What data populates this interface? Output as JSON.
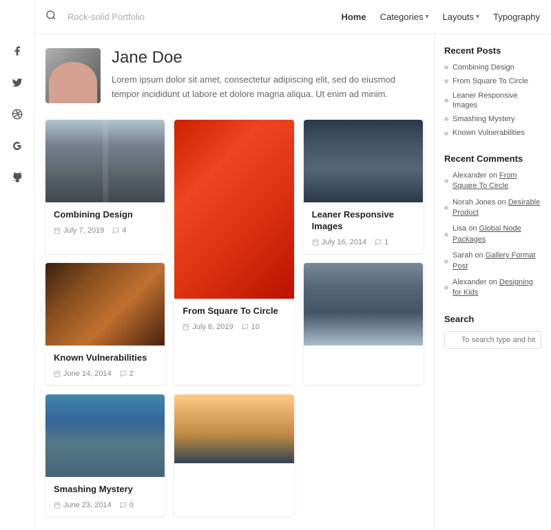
{
  "nav": {
    "site_title": "Rock-solid Portfolio",
    "links": [
      {
        "label": "Home",
        "active": true,
        "has_dropdown": false
      },
      {
        "label": "Categories",
        "active": false,
        "has_dropdown": true
      },
      {
        "label": "Layouts",
        "active": false,
        "has_dropdown": true
      },
      {
        "label": "Typography",
        "active": false,
        "has_dropdown": false
      }
    ]
  },
  "social": [
    {
      "icon": "facebook",
      "symbol": "f"
    },
    {
      "icon": "twitter",
      "symbol": "t"
    },
    {
      "icon": "dribbble",
      "symbol": "◎"
    },
    {
      "icon": "google",
      "symbol": "G"
    },
    {
      "icon": "github",
      "symbol": "⊙"
    }
  ],
  "profile": {
    "name": "Jane Doe",
    "bio": "Lorem ipsum dolor sit amet, consectetur adipiscing elit, sed do eiusmod tempor incididunt ut labore et dolore magna aliqua. Ut enim ad minim."
  },
  "posts": [
    {
      "id": 1,
      "title": "Combining Design",
      "date": "July 7, 2019",
      "comments": "4",
      "image_type": "railway",
      "col": 1
    },
    {
      "id": 2,
      "title": "From Square To Circle",
      "date": "July 6, 2019",
      "comments": "10",
      "image_type": "strawberries",
      "col": 2,
      "tall": true
    },
    {
      "id": 3,
      "title": "Leaner Responsive Images",
      "date": "July 16, 2014",
      "comments": "1",
      "image_type": "eyes",
      "col": 3
    },
    {
      "id": 4,
      "title": "Known Vulnerabilities",
      "date": "June 14, 2014",
      "comments": "2",
      "image_type": "concert",
      "col": 1
    },
    {
      "id": 5,
      "title": "Smashing Mystery",
      "date": "June 23, 2014",
      "comments": "0",
      "image_type": "kayak",
      "col": 3
    },
    {
      "id": 6,
      "title": "",
      "date": "",
      "comments": "",
      "image_type": "mountain",
      "col": 2
    },
    {
      "id": 7,
      "title": "",
      "date": "",
      "comments": "",
      "image_type": "person",
      "col": 3
    }
  ],
  "sidebar": {
    "recent_posts_title": "Recent Posts",
    "recent_posts": [
      {
        "label": "Combining Design"
      },
      {
        "label": "From Square To Circle"
      },
      {
        "label": "Leaner Responsive Images"
      },
      {
        "label": "Smashing Mystery"
      },
      {
        "label": "Known Vulnerabilities"
      }
    ],
    "recent_comments_title": "Recent Comments",
    "recent_comments": [
      {
        "text": "Alexander on From Square To Circle"
      },
      {
        "text": "Norah Jones on Desirable Product"
      },
      {
        "text": "Lisa on Global Node Packages"
      },
      {
        "text": "Sarah on Gallery Format Post"
      },
      {
        "text": "Alexander on Designing for Kids"
      }
    ],
    "search_title": "Search",
    "search_placeholder": "To search type and hit enter"
  }
}
